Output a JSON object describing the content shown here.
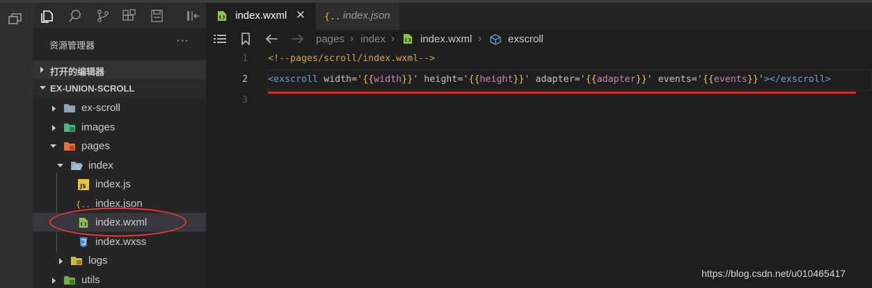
{
  "colors": {
    "accent_red": "#e53935",
    "tag": "#6a9fd8",
    "string": "#e6b96a",
    "variable": "#c586c0",
    "wxml_icon": "#8bc34a",
    "json_icon": "#f0b429",
    "folder": "#8fa3b8",
    "images_folder": "#4fb38a",
    "pages_folder": "#e8703a",
    "js_icon": "#e8c43a",
    "wxss_icon": "#4a90d9",
    "logs_folder": "#c9b94a",
    "utils_folder": "#6fb04a"
  },
  "activity_bar": {
    "icon": "window-restore-icon"
  },
  "toolbar": {
    "icons": [
      "files-icon",
      "search-icon",
      "source-control-icon",
      "extensions-icon",
      "save-icon",
      "panel-left-icon"
    ]
  },
  "explorer": {
    "title": "资源管理器",
    "more": "···",
    "open_editors": "打开的编辑器",
    "project": "EX-UNION-SCROLL",
    "items": [
      {
        "name": "ex-scroll",
        "icon": "folder-icon",
        "chevron": "right"
      },
      {
        "name": "images",
        "icon": "images-folder-icon",
        "chevron": "right"
      },
      {
        "name": "pages",
        "icon": "pages-folder-icon",
        "chevron": "down"
      },
      {
        "name": "index",
        "icon": "folder-open-icon",
        "chevron": "down"
      },
      {
        "name": "index.js",
        "icon": "js-file-icon"
      },
      {
        "name": "index.json",
        "icon": "json-file-icon"
      },
      {
        "name": "index.wxml",
        "icon": "wxml-file-icon",
        "selected": true
      },
      {
        "name": "index.wxss",
        "icon": "wxss-file-icon"
      },
      {
        "name": "logs",
        "icon": "logs-folder-icon",
        "chevron": "right"
      },
      {
        "name": "utils",
        "icon": "utils-folder-icon",
        "chevron": "right"
      }
    ]
  },
  "tabs": [
    {
      "label": "index.wxml",
      "icon": "wxml-file-icon",
      "active": true,
      "close": "✕"
    },
    {
      "label": "index.json",
      "icon": "json-file-icon",
      "active": false
    }
  ],
  "breadcrumb": [
    "pages",
    "index",
    "index.wxml",
    "exscroll"
  ],
  "editor": {
    "line_numbers": [
      "1",
      "2",
      "3"
    ],
    "line1": "<!--pages/scroll/index.wxml-->",
    "line2": {
      "open_tag": "<exscroll",
      "attrs": [
        {
          "name": "width",
          "value": "width"
        },
        {
          "name": "height",
          "value": "height"
        },
        {
          "name": "adapter",
          "value": "adapter"
        },
        {
          "name": "events",
          "value": "events"
        }
      ],
      "close_tag": "></exscroll>"
    }
  },
  "watermark": "https://blog.csdn.net/u010465417"
}
